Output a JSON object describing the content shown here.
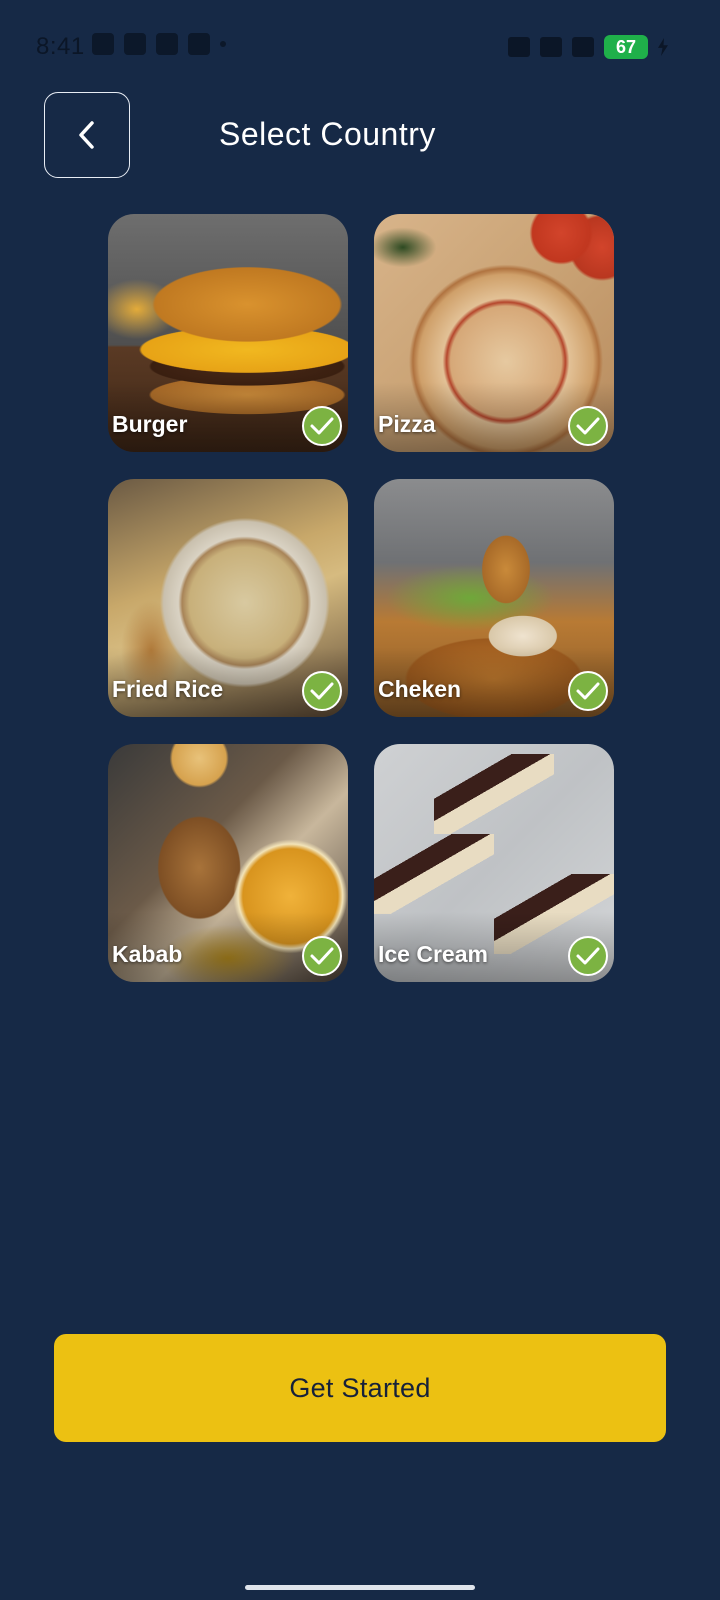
{
  "status_bar": {
    "time": "8:41",
    "battery": "67"
  },
  "header": {
    "title": "Select Country"
  },
  "categories": [
    {
      "label": "Burger",
      "selected": true
    },
    {
      "label": "Pizza",
      "selected": true
    },
    {
      "label": "Fried Rice",
      "selected": true
    },
    {
      "label": "Cheken",
      "selected": true
    },
    {
      "label": "Kabab",
      "selected": true
    },
    {
      "label": "Ice Cream",
      "selected": true
    }
  ],
  "footer": {
    "button_label": "Get Started"
  },
  "colors": {
    "background": "#162946",
    "accent": "#ecc112",
    "check": "#7cb342"
  },
  "icons": [
    "back-arrow-icon",
    "check-icon"
  ]
}
